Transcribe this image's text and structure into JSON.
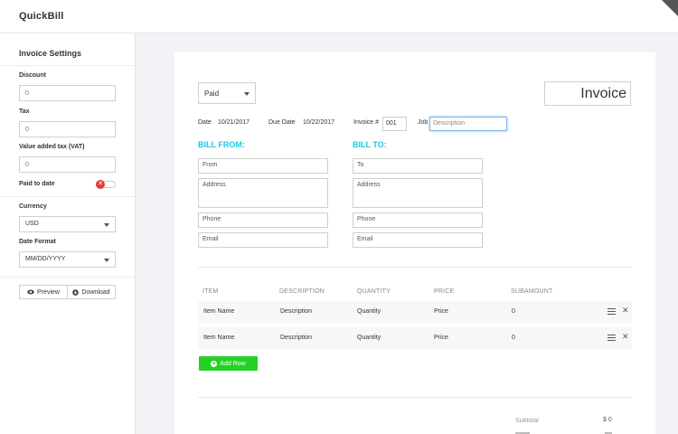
{
  "app": {
    "title": "QuickBill"
  },
  "sidebar": {
    "title": "Invoice Settings",
    "discount": {
      "label": "Discount",
      "placeholder": "0"
    },
    "tax": {
      "label": "Tax",
      "placeholder": "0"
    },
    "vat": {
      "label": "Value added tax (VAT)",
      "placeholder": "0"
    },
    "paid": {
      "label": "Paid to date",
      "toggle_on": false
    },
    "currency": {
      "label": "Currency",
      "value": "USD"
    },
    "date_format": {
      "label": "Date Format",
      "value": "MM/DD/YYYY"
    },
    "preview_label": "Preview",
    "download_label": "Download"
  },
  "invoice": {
    "status": "Paid",
    "title": "Invoice",
    "date_label": "Date",
    "date_value": "10/21/2017",
    "due_label": "Due Date",
    "due_value": "10/22/2017",
    "number_label": "Invoice #",
    "number_value": "001",
    "job_label": "Job",
    "job_placeholder": "Description",
    "bill_from": {
      "heading": "BILL FROM:",
      "from": "From",
      "address": "Address",
      "phone": "Phone",
      "email": "Email"
    },
    "bill_to": {
      "heading": "BILL TO:",
      "to": "To",
      "address": "Address",
      "phone": "Phone",
      "email": "Email"
    },
    "columns": [
      "ITEM",
      "DESCRIPTION",
      "QUANTITY",
      "PRICE",
      "SUBAMOUNT"
    ],
    "rows": [
      {
        "item": "Item Name",
        "description": "Description",
        "quantity": "Quantity",
        "price": "Price",
        "subamount": "0"
      },
      {
        "item": "Item Name",
        "description": "Description",
        "quantity": "Quantity",
        "price": "Price",
        "subamount": "0"
      }
    ],
    "add_row_label": "Add Row",
    "subtotal_label": "Subtotal",
    "subtotal_value": "$ 0"
  },
  "icons": {
    "preview": "eye-icon",
    "download": "download-icon",
    "row_menu": "hamburger-icon",
    "row_delete": "close-icon",
    "add": "plus-circle-icon",
    "toggle_off": "x-icon"
  },
  "colors": {
    "accent": "#1ec6e6",
    "add_button": "#25d125",
    "toggle_off": "#e53935",
    "focus": "#7fb7e8"
  }
}
